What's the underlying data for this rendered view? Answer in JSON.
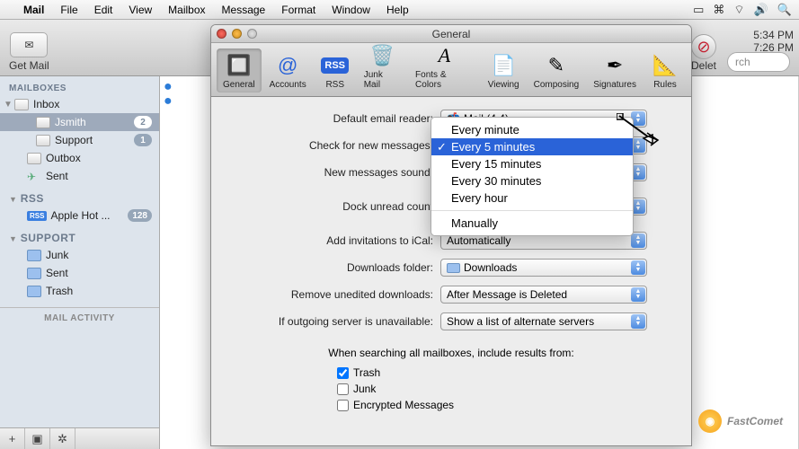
{
  "menubar": {
    "app": "Mail",
    "items": [
      "File",
      "Edit",
      "View",
      "Mailbox",
      "Message",
      "Format",
      "Window",
      "Help"
    ]
  },
  "mail_toolbar": {
    "get_mail": "Get Mail",
    "delete": "Delet",
    "search_placeholder": "rch"
  },
  "times": {
    "a": "5:34 PM",
    "b": "7:26 PM"
  },
  "sidebar": {
    "section_mailboxes": "MAILBOXES",
    "inbox": "Inbox",
    "jsmith": "Jsmith",
    "jsmith_badge": "2",
    "support": "Support",
    "support_badge": "1",
    "outbox": "Outbox",
    "sent": "Sent",
    "section_rss": "RSS",
    "apple_hot": "Apple Hot ...",
    "apple_hot_badge": "128",
    "section_support": "SUPPORT",
    "junk": "Junk",
    "sent2": "Sent",
    "trash": "Trash",
    "activity": "MAIL ACTIVITY"
  },
  "pref": {
    "title": "General",
    "tabs": {
      "general": "General",
      "accounts": "Accounts",
      "rss": "RSS",
      "junk": "Junk Mail",
      "fonts": "Fonts & Colors",
      "viewing": "Viewing",
      "composing": "Composing",
      "signatures": "Signatures",
      "rules": "Rules"
    },
    "labels": {
      "default_reader": "Default email reader:",
      "check_new": "Check for new messages:",
      "new_sound": "New messages sound:",
      "dock_unread": "Dock unread count",
      "add_ical": "Add invitations to iCal:",
      "downloads_folder": "Downloads folder:",
      "remove_downloads": "Remove unedited downloads:",
      "outgoing_unavailable": "If outgoing server is unavailable:",
      "search_header": "When searching all mailboxes, include results from:",
      "cb_trash": "Trash",
      "cb_junk": "Junk",
      "cb_encrypted": "Encrypted Messages"
    },
    "values": {
      "default_reader": "Mail (4.4)",
      "add_ical": "Automatically",
      "downloads_folder": "Downloads",
      "remove_downloads": "After Message is Deleted",
      "outgoing_unavailable": "Show a list of alternate servers"
    }
  },
  "dropdown": {
    "opt1": "Every minute",
    "opt2": "Every 5 minutes",
    "opt3": "Every 15 minutes",
    "opt4": "Every 30 minutes",
    "opt5": "Every hour",
    "opt6": "Manually"
  },
  "watermark": {
    "text": "FastComet"
  }
}
